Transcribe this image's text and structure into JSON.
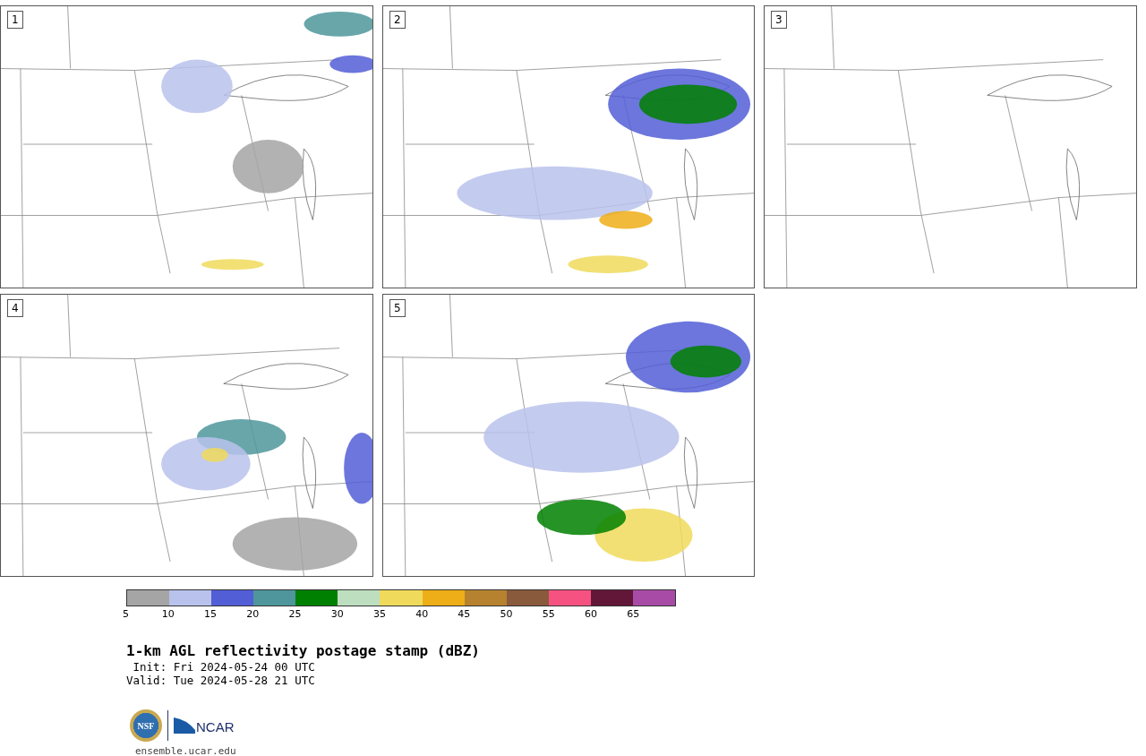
{
  "panels": [
    {
      "label": "1"
    },
    {
      "label": "2"
    },
    {
      "label": "3"
    },
    {
      "label": "4"
    },
    {
      "label": "5"
    }
  ],
  "colorbar": {
    "segments": [
      {
        "color": "#a5a5a5",
        "tick": "5"
      },
      {
        "color": "#b8c2ec",
        "tick": "10"
      },
      {
        "color": "#525ed6",
        "tick": "15"
      },
      {
        "color": "#4e969b",
        "tick": "20"
      },
      {
        "color": "#008000",
        "tick": "25"
      },
      {
        "color": "#bedfbf",
        "tick": "30"
      },
      {
        "color": "#f0da5c",
        "tick": "35"
      },
      {
        "color": "#eeae17",
        "tick": "40"
      },
      {
        "color": "#b78230",
        "tick": "45"
      },
      {
        "color": "#8a5a3c",
        "tick": "50"
      },
      {
        "color": "#f55282",
        "tick": "55"
      },
      {
        "color": "#621738",
        "tick": "60"
      },
      {
        "color": "#a84ba7",
        "tick": "65"
      }
    ]
  },
  "title": "1-km AGL reflectivity postage stamp (dBZ)",
  "init": " Init: Fri 2024-05-24 00 UTC",
  "valid": "Valid: Tue 2024-05-28 21 UTC",
  "logos": {
    "nsf": "NSF",
    "ncar": "NCAR"
  },
  "site": "ensemble.ucar.edu"
}
